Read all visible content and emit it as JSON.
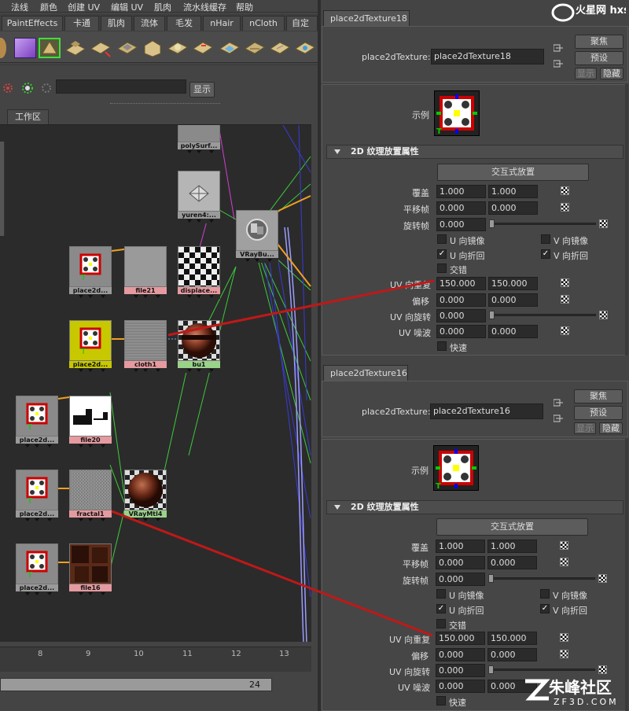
{
  "menu": [
    "法线",
    "颜色",
    "创建 UV",
    "编辑 UV",
    "肌肉",
    "流水线缓存",
    "帮助"
  ],
  "shelf_tabs": [
    "PaintEffects",
    "卡通",
    "肌肉",
    "流体",
    "毛发",
    "nHair",
    "nCloth",
    "自定义"
  ],
  "hypershade": {
    "display_button": "显示",
    "work_area_tab": "工作区",
    "nodes": {
      "polySurf": "polySurf...",
      "yuren4": "yuren4:...",
      "vraybump": "VRayBu...",
      "place2d_a": "place2d...",
      "file21": "file21",
      "displace": "displace...",
      "place2d_b": "place2d...",
      "cloth1": "cloth1",
      "bu1": "bu1",
      "place2d_c": "place2d...",
      "file20": "file20",
      "place2d_d": "place2d...",
      "fractal1": "fractal1",
      "vraymtl4": "VRayMtl4",
      "place2d_e": "place2d...",
      "file16": "file16"
    }
  },
  "timeline": {
    "ticks": [
      "8",
      "9",
      "10",
      "11",
      "12",
      "13"
    ],
    "range_end": "24"
  },
  "watermarks": {
    "top": "火星网 hxsd.com",
    "bottom_cn": "朱峰社区",
    "bottom_en": "ZF3D.COM"
  },
  "panels": [
    {
      "tab": "place2dTexture18",
      "name_label": "place2dTexture:",
      "name_value": "place2dTexture18",
      "focus": "聚焦",
      "presets": "预设",
      "show": "显示",
      "hide": "隐藏",
      "sample_label": "示例",
      "section_title": "2D 纹理放置属性",
      "interactive": "交互式放置",
      "coverage_label": "覆盖",
      "coverage": [
        "1.000",
        "1.000"
      ],
      "translate_label": "平移帧",
      "translate": [
        "0.000",
        "0.000"
      ],
      "rotate_label": "旋转帧",
      "rotate": "0.000",
      "mirror_u": "U 向镜像",
      "mirror_v": "V 向镜像",
      "wrap_u": "U 向折回",
      "wrap_v": "V 向折回",
      "stagger": "交错",
      "repeat_label": "UV 向重复",
      "repeat": [
        "150.000",
        "150.000"
      ],
      "offset_label": "偏移",
      "offset": [
        "0.000",
        "0.000"
      ],
      "rotate_uv_label": "UV 向旋转",
      "rotate_uv": "0.000",
      "noise_label": "UV 噪波",
      "noise": [
        "0.000",
        "0.000"
      ],
      "fast": "快速"
    },
    {
      "tab": "place2dTexture16",
      "name_label": "place2dTexture:",
      "name_value": "place2dTexture16",
      "focus": "聚焦",
      "presets": "预设",
      "show": "显示",
      "hide": "隐藏",
      "sample_label": "示例",
      "section_title": "2D 纹理放置属性",
      "interactive": "交互式放置",
      "coverage_label": "覆盖",
      "coverage": [
        "1.000",
        "1.000"
      ],
      "translate_label": "平移帧",
      "translate": [
        "0.000",
        "0.000"
      ],
      "rotate_label": "旋转帧",
      "rotate": "0.000",
      "mirror_u": "U 向镜像",
      "mirror_v": "V 向镜像",
      "wrap_u": "U 向折回",
      "wrap_v": "V 向折回",
      "stagger": "交错",
      "repeat_label": "UV 向重复",
      "repeat": [
        "150.000",
        "150.000"
      ],
      "offset_label": "偏移",
      "offset": [
        "0.000",
        "0.000"
      ],
      "rotate_uv_label": "UV 向旋转",
      "rotate_uv": "0.000",
      "noise_label": "UV 噪波",
      "noise": [
        "0.000",
        "0.000"
      ],
      "fast": "快速"
    }
  ],
  "colors": {
    "annotation_line": "#c01818",
    "texture_connection": "#f0a020",
    "material_connection": "#3ccc3c"
  }
}
